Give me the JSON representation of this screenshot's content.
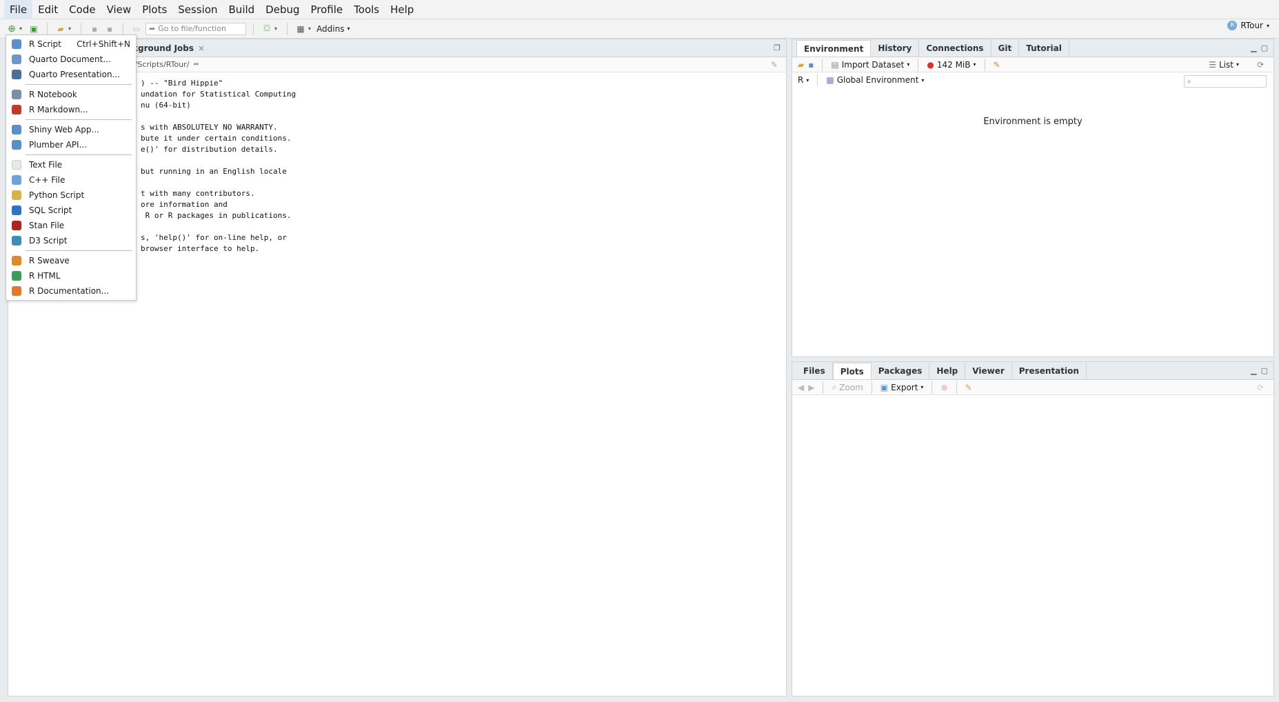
{
  "menubar": {
    "items": [
      "File",
      "Edit",
      "Code",
      "View",
      "Plots",
      "Session",
      "Build",
      "Debug",
      "Profile",
      "Tools",
      "Help"
    ]
  },
  "toolbar": {
    "goto_placeholder": "Go to file/function",
    "addins_label": "Addins",
    "project_label": "RTour"
  },
  "left_pane": {
    "tab_label": "kground Jobs",
    "path": "s/Scripts/RTour/",
    "console_lines": [
      ") -- \"Bird Hippie\"",
      "undation for Statistical Computing",
      "nu (64-bit)",
      "",
      "s with ABSOLUTELY NO WARRANTY.",
      "bute it under certain conditions.",
      "e()' for distribution details.",
      "",
      "but running in an English locale",
      "",
      "t with many contributors.",
      "ore information and",
      " R or R packages in publications.",
      "",
      "s, 'help()' for on-line help, or",
      "browser interface to help."
    ]
  },
  "new_file_menu": {
    "groups": [
      [
        {
          "label": "R Script",
          "shortcut": "Ctrl+Shift+N",
          "icon": "r-script-icon",
          "color": "#5b8fc9"
        },
        {
          "label": "Quarto Document...",
          "icon": "quarto-document-icon",
          "color": "#6e98c7"
        },
        {
          "label": "Quarto Presentation...",
          "icon": "quarto-presentation-icon",
          "color": "#4b6f97"
        }
      ],
      [
        {
          "label": "R Notebook",
          "icon": "r-notebook-icon",
          "color": "#7a8fa8"
        },
        {
          "label": "R Markdown...",
          "icon": "r-markdown-icon",
          "color": "#c0392b"
        }
      ],
      [
        {
          "label": "Shiny Web App...",
          "icon": "shiny-icon",
          "color": "#5b8fc9"
        },
        {
          "label": "Plumber API...",
          "icon": "plumber-icon",
          "color": "#5b8fc9"
        }
      ],
      [
        {
          "label": "Text File",
          "icon": "text-file-icon",
          "color": "#e8e8e8"
        },
        {
          "label": "C++ File",
          "icon": "cpp-file-icon",
          "color": "#6ea3d8"
        },
        {
          "label": "Python Script",
          "icon": "python-icon",
          "color": "#d9b24a"
        },
        {
          "label": "SQL Script",
          "icon": "sql-icon",
          "color": "#2f73c4"
        },
        {
          "label": "Stan File",
          "icon": "stan-icon",
          "color": "#b22222"
        },
        {
          "label": "D3 Script",
          "icon": "d3-icon",
          "color": "#3a8fb7"
        }
      ],
      [
        {
          "label": "R Sweave",
          "icon": "sweave-icon",
          "color": "#e08b2a"
        },
        {
          "label": "R HTML",
          "icon": "r-html-icon",
          "color": "#3b9b5a"
        },
        {
          "label": "R Documentation...",
          "icon": "r-doc-icon",
          "color": "#e07a2a"
        }
      ]
    ]
  },
  "right_top": {
    "tabs": [
      "Environment",
      "History",
      "Connections",
      "Git",
      "Tutorial"
    ],
    "active_tab": "Environment",
    "import_label": "Import Dataset",
    "memory_label": "142 MiB",
    "list_label": "List",
    "lang_label": "R",
    "env_label": "Global Environment",
    "empty_text": "Environment is empty"
  },
  "right_bottom": {
    "tabs": [
      "Files",
      "Plots",
      "Packages",
      "Help",
      "Viewer",
      "Presentation"
    ],
    "active_tab": "Plots",
    "zoom_label": "Zoom",
    "export_label": "Export"
  }
}
